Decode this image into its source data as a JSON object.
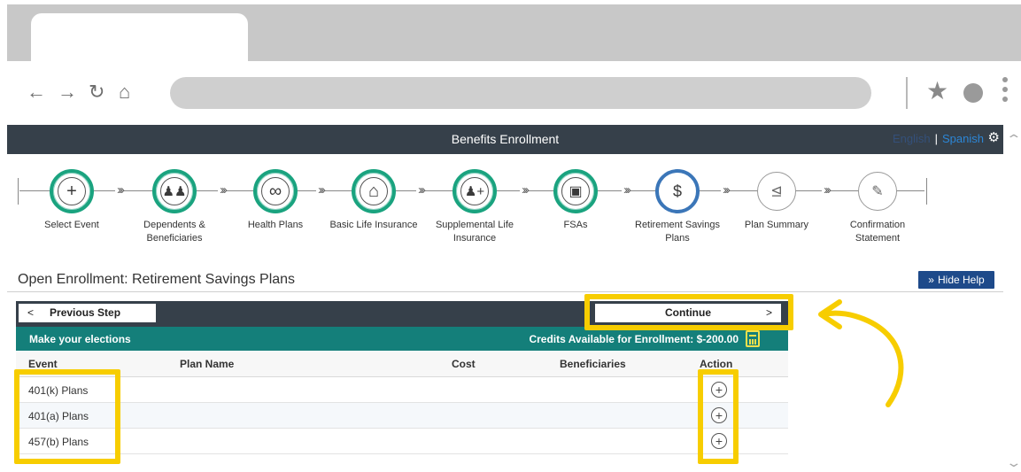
{
  "app": {
    "title": "Benefits Enrollment",
    "lang_english": "English",
    "lang_sep": "|",
    "lang_spanish": "Spanish"
  },
  "steps": [
    {
      "label": "Select Event",
      "status": "complete",
      "icon": "plus-circle-icon"
    },
    {
      "label": "Dependents & Beneficiaries",
      "status": "complete",
      "icon": "people-icon"
    },
    {
      "label": "Health Plans",
      "status": "complete",
      "icon": "stethoscope-icon"
    },
    {
      "label": "Basic Life Insurance",
      "status": "complete",
      "icon": "house-people-icon"
    },
    {
      "label": "Supplemental Life Insurance",
      "status": "complete",
      "icon": "person-plus-icon"
    },
    {
      "label": "FSAs",
      "status": "complete",
      "icon": "wallet-icon"
    },
    {
      "label": "Retirement Savings Plans",
      "status": "current",
      "icon": "money-bag-icon"
    },
    {
      "label": "Plan Summary",
      "status": "pending",
      "icon": "chart-plus-icon"
    },
    {
      "label": "Confirmation Statement",
      "status": "pending",
      "icon": "document-sign-icon"
    }
  ],
  "page": {
    "title": "Open Enrollment: Retirement Savings Plans",
    "hide_help": "Hide Help"
  },
  "nav": {
    "previous": "Previous Step",
    "continue": "Continue"
  },
  "elections": {
    "heading": "Make your elections",
    "credits": "Credits Available for Enrollment: $-200.00"
  },
  "table": {
    "columns": [
      "Event",
      "Plan Name",
      "Cost",
      "Beneficiaries",
      "Action"
    ],
    "rows": [
      {
        "event": "401(k) Plans"
      },
      {
        "event": "401(a) Plans"
      },
      {
        "event": "457(b) Plans"
      }
    ]
  },
  "colors": {
    "appbar": "#36404a",
    "step_complete": "#1aa37f",
    "step_current": "#3b76b8",
    "elections_bar": "#147f7a",
    "highlight": "#f7cd00",
    "hide_help": "#1e4a8a"
  }
}
